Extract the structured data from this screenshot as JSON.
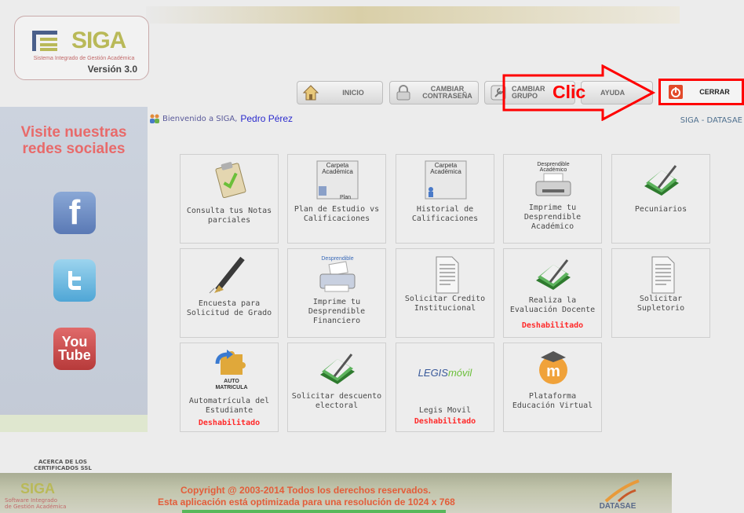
{
  "header": {
    "logo_word": "SIGA",
    "logo_subtitle": "Sistema Integrado de Gestión Académica",
    "version": "Versión 3.0"
  },
  "nav": {
    "inicio": "INICIO",
    "cambiar_contrasena": [
      "CAMBIAR",
      "CONTRASEÑA"
    ],
    "cambiar_grupo": [
      "CAMBIAR",
      "GRUPO"
    ],
    "ayuda": "AYUDA",
    "cerrar": "CERRAR"
  },
  "annotation": {
    "clic": "Clic",
    "color": "#ff0000"
  },
  "welcome": {
    "text": "Bienvenido a SIGA,",
    "user": "Pedro Pérez",
    "org": "SIGA - DATASAE"
  },
  "sidebar": {
    "title": [
      "Visite nuestras",
      "redes sociales"
    ],
    "facebook": "f",
    "youtube": [
      "You",
      "Tube"
    ]
  },
  "tiles": {
    "notas": {
      "caption": [
        "Consulta tus Notas",
        "parciales"
      ],
      "icon": "clipboard-check-icon"
    },
    "plan": {
      "caption": [
        "Plan de Estudio vs",
        "Calificaciones"
      ],
      "icon_title": [
        "Carpeta",
        "Académica"
      ],
      "icon_sub": "Plan"
    },
    "historial": {
      "caption": [
        "Historial de",
        "Calificaciones"
      ],
      "icon_title": [
        "Carpeta",
        "Académica"
      ]
    },
    "desprendible_academico": {
      "caption": [
        "Imprime tu",
        "Desprendible",
        "Académico"
      ],
      "icon_title": [
        "Desprendible",
        "Académico"
      ]
    },
    "pecuniarios": {
      "caption": [
        "Pecuniarios"
      ],
      "icon": "green-book-pen-icon"
    },
    "encuesta": {
      "caption": [
        "Encuesta para",
        "Solicitud de Grado"
      ],
      "icon": "fountain-pen-icon"
    },
    "desprendible_financiero": {
      "caption": [
        "Imprime tu",
        "Desprendible",
        "Financiero"
      ],
      "icon_title": "Desprendible"
    },
    "credito": {
      "caption": [
        "Solicitar Credito",
        "Institucional"
      ],
      "icon": "document-icon"
    },
    "evaluacion": {
      "caption": [
        "Realiza la",
        "Evaluación Docente"
      ],
      "status": "Deshabilitado"
    },
    "supletorio": {
      "caption": [
        "Solicitar Supletorio"
      ],
      "icon": "document-icon"
    },
    "automatricula": {
      "caption": [
        "Automatrícula del",
        "Estudiante"
      ],
      "icon_title": [
        "AUTO",
        "MATRICULA"
      ],
      "status": "Deshabilitado"
    },
    "descuento": {
      "caption": [
        "Solicitar descuento",
        "electoral"
      ],
      "icon": "green-book-pen-icon"
    },
    "legis": {
      "caption": [
        "Legis Movil"
      ],
      "logo": [
        "LEGIS",
        "móvil"
      ],
      "status": "Deshabilitado"
    },
    "plataforma": {
      "caption": [
        "Plataforma",
        "Educación Virtual"
      ],
      "icon": "moodle-icon"
    }
  },
  "footer": {
    "ssl": [
      "ACERCA DE LOS",
      "CERTIFICADOS SSL"
    ],
    "logo_word": "SIGA",
    "logo_sub": [
      "Software Integrado",
      "de Gestión Académica"
    ],
    "copyright": "Copyright @ 2003-2014 Todos los derechos reservados.",
    "resolution": "Esta aplicación está optimizada para una resolución de 1024 x 768",
    "datasae": "DATASAE"
  }
}
